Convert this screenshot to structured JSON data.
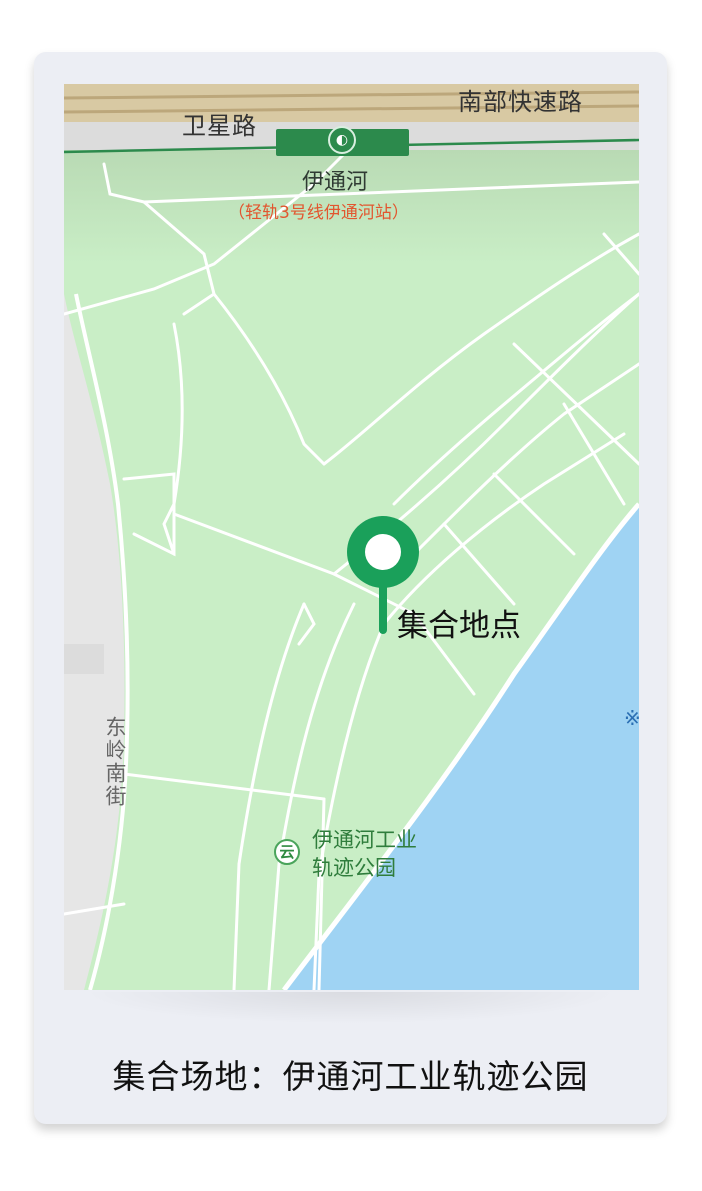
{
  "map": {
    "roads": {
      "south_expressway": "南部快速路",
      "weixing_road": "卫星路",
      "dongling_south_street": "东岭南街"
    },
    "station": {
      "name": "伊通河",
      "subtitle": "（轻轨3号线伊通河站）",
      "icon": "light-rail-station-icon"
    },
    "park": {
      "name_line1": "伊通河工业",
      "name_line2": "轨迹公园",
      "icon": "park-icon",
      "icon_glyph": "云"
    },
    "pin": {
      "label": "集合地点",
      "color": "#1aa05a",
      "icon": "location-pin-icon"
    },
    "water_icon": "※",
    "colors": {
      "park_green": "#c9eec6",
      "water_blue": "#9fd3f3",
      "road_white": "#ffffff",
      "rail_line": "#2c8a4c",
      "expressway": "#cdb98f"
    }
  },
  "caption": "集合场地：伊通河工业轨迹公园"
}
